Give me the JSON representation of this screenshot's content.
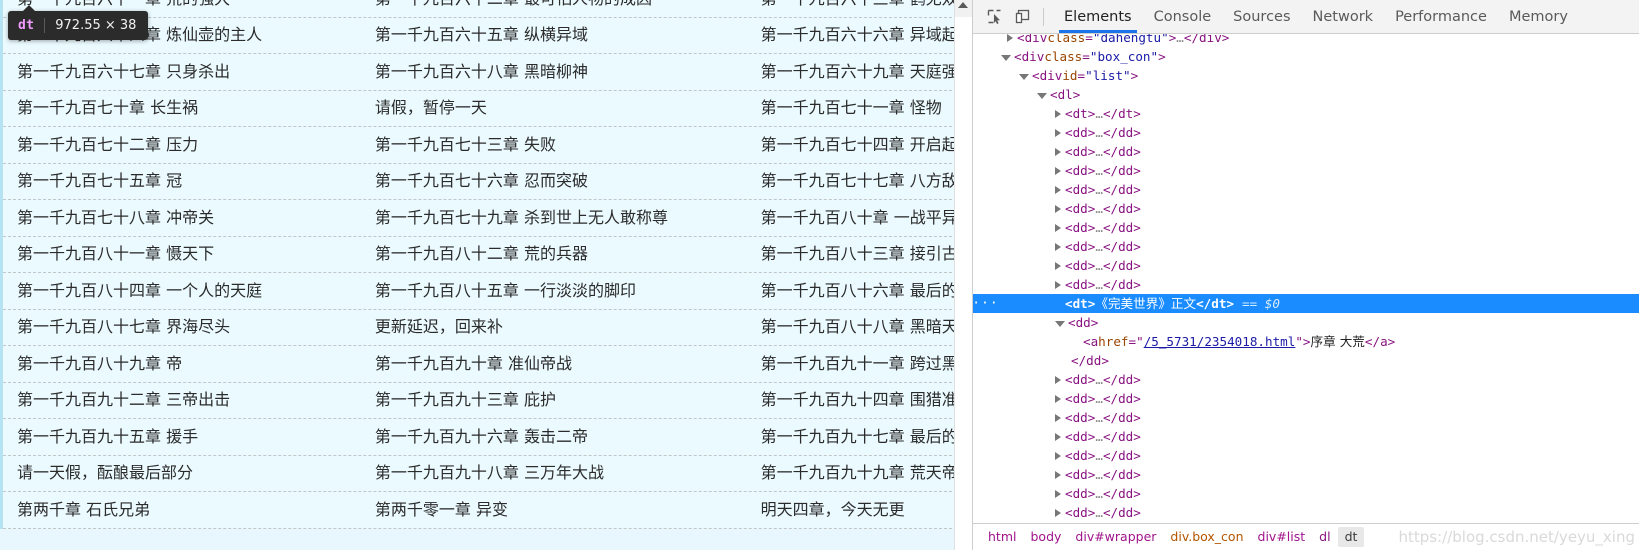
{
  "page": {
    "rows": [
      [
        "第一千九百六十一章  荒的强大",
        "第一千九百六十二章  最可怕人物的成因",
        "第一千九百六十三章  鹤无双"
      ],
      [
        "第一千九百六十四章  炼仙壶的主人",
        "第一千九百六十五章  纵横异域",
        "第一千九百六十六章  异域起"
      ],
      [
        "第一千九百六十七章  只身杀出",
        "第一千九百六十八章  黑暗柳神",
        "第一千九百六十九章  天庭强"
      ],
      [
        "第一千九百七十章  长生祸",
        "请假，暂停一天",
        "第一千九百七十一章  怪物"
      ],
      [
        "第一千九百七十二章  压力",
        "第一千九百七十三章  失败",
        "第一千九百七十四章  开启起"
      ],
      [
        "第一千九百七十五章  冠",
        "第一千九百七十六章  忍而突破",
        "第一千九百七十七章  八方敌"
      ],
      [
        "第一千九百七十八章  冲帝关",
        "第一千九百七十九章  杀到世上无人敢称尊",
        "第一千九百八十章  一战平异"
      ],
      [
        "第一千九百八十一章  慑天下",
        "第一千九百八十二章  荒的兵器",
        "第一千九百八十三章  接引古"
      ],
      [
        "第一千九百八十四章  一个人的天庭",
        "第一千九百八十五章  一行淡淡的脚印",
        "第一千九百八十六章  最后的"
      ],
      [
        "第一千九百八十七章  界海尽头",
        "更新延迟，回来补",
        "第一千九百八十八章  黑暗天"
      ],
      [
        "第一千九百八十九章  帝",
        "第一千九百九十章  准仙帝战",
        "第一千九百九十一章  跨过黑"
      ],
      [
        "第一千九百九十二章  三帝出击",
        "第一千九百九十三章  庇护",
        "第一千九百九十四章  围猎准"
      ],
      [
        "第一千九百九十五章  援手",
        "第一千九百九十六章  轰击二帝",
        "第一千九百九十七章  最后的"
      ],
      [
        "请一天假，酝酿最后部分",
        "第一千九百九十八章  三万年大战",
        "第一千九百九十九章  荒天帝"
      ],
      [
        "第两千章  石氏兄弟",
        "第两千零一章  异变",
        "明天四章，今天无更"
      ]
    ]
  },
  "inspect_tooltip": {
    "tag": "dt",
    "size": "972.55 × 38"
  },
  "devtools": {
    "toolbar": {
      "inspect_icon": "inspect-cursor-icon",
      "device_icon": "device-toolbar-icon"
    },
    "tabs": [
      {
        "label": "Elements",
        "active": true
      },
      {
        "label": "Console",
        "active": false
      },
      {
        "label": "Sources",
        "active": false
      },
      {
        "label": "Network",
        "active": false
      },
      {
        "label": "Performance",
        "active": false
      },
      {
        "label": "Memory",
        "active": false
      }
    ],
    "dom": {
      "line_dahengtu_tag": "div",
      "line_dahengtu_attr": "class",
      "line_dahengtu_val": "\"dahengtu\"",
      "line_boxcon_tag": "div",
      "line_boxcon_attr": "class",
      "line_boxcon_val": "\"box_con\"",
      "line_list_tag": "div",
      "line_list_attr": "id",
      "line_list_val": "\"list\"",
      "line_dl": "dl",
      "dt_collapsed": "dt",
      "dd_collapsed": "dd",
      "ellipsis": "…",
      "selected_dt_open": "<dt>",
      "selected_dt_text": "《完美世界》正文",
      "selected_dt_close": "</dt>",
      "selected_marker": "== $0",
      "dd_open": "<dd>",
      "dd_close": "</dd>",
      "anchor_tag": "a",
      "anchor_attr": "href",
      "anchor_href": "/5_5731/2354018.html",
      "anchor_text": "序章  大荒",
      "dots": "···"
    },
    "breadcrumb": [
      {
        "label": "html",
        "kind": "magenta",
        "selected": false
      },
      {
        "label": "body",
        "kind": "magenta",
        "selected": false
      },
      {
        "label": "div#wrapper",
        "kind": "magenta",
        "selected": false
      },
      {
        "label": "div.box_con",
        "kind": "orange",
        "selected": false
      },
      {
        "label": "div#list",
        "kind": "magenta",
        "selected": false
      },
      {
        "label": "dl",
        "kind": "purple",
        "selected": false
      },
      {
        "label": "dt",
        "kind": "plain",
        "selected": true
      }
    ],
    "watermark": "https://blog.csdn.net/yeyu_xing"
  }
}
